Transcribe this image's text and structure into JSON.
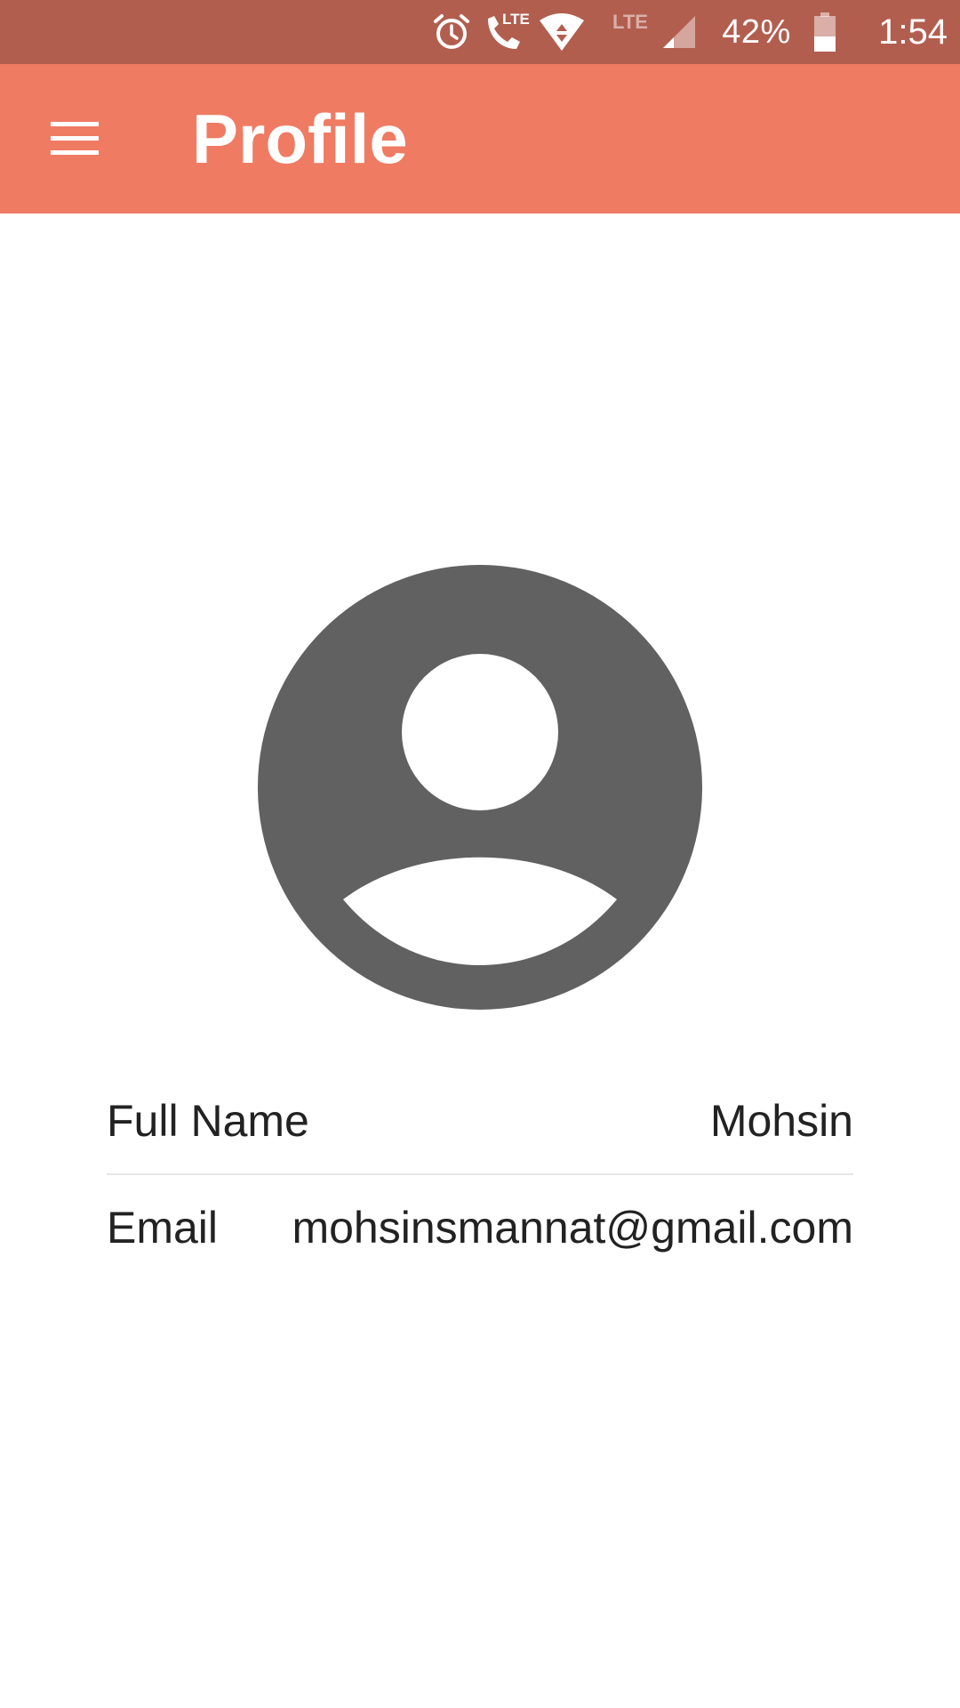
{
  "status_bar": {
    "lte_label": "LTE",
    "volte_label": "LTE",
    "battery_percent": "42%",
    "battery_level": 0.42,
    "time": "1:54",
    "icons": [
      "alarm-icon",
      "volte-call-icon",
      "wifi-icon",
      "signal-icon",
      "battery-icon"
    ]
  },
  "app_bar": {
    "title": "Profile",
    "menu_icon": "hamburger-menu-icon",
    "color": "#ef7b63"
  },
  "status_bar_color": "#b25e4f",
  "avatar": {
    "icon": "account-circle-icon",
    "color": "#616161"
  },
  "profile": {
    "full_name_label": "Full Name",
    "full_name_value": "Mohsin",
    "email_label": "Email",
    "email_value": "mohsinsmannat@gmail.com"
  }
}
